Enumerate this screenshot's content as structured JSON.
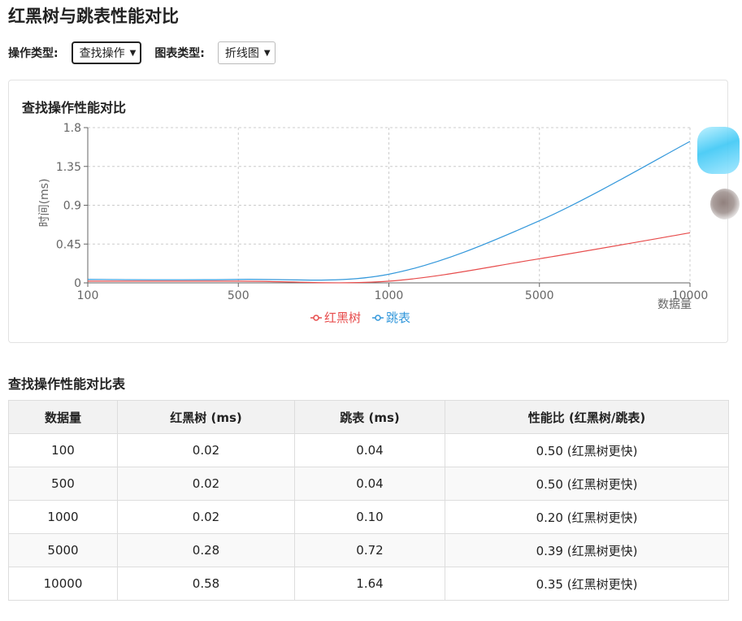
{
  "page": {
    "title": "红黑树与跳表性能对比",
    "op_label": "操作类型:",
    "op_value": "查找操作",
    "chart_label": "图表类型:",
    "chart_value": "折线图"
  },
  "chart_card": {
    "title": "查找操作性能对比"
  },
  "colors": {
    "rbtree": "#e74c4c",
    "skiplist": "#3498db"
  },
  "chart_data": {
    "type": "line",
    "title": "查找操作性能对比",
    "xlabel": "数据量",
    "ylabel": "时间(ms)",
    "categories": [
      "100",
      "500",
      "1000",
      "5000",
      "10000"
    ],
    "ylim": [
      0,
      1.8
    ],
    "yticks": [
      0,
      0.45,
      0.9,
      1.35,
      1.8
    ],
    "grid": true,
    "legend": "bottom",
    "series": [
      {
        "name": "红黑树",
        "values": [
          0.02,
          0.02,
          0.02,
          0.28,
          0.58
        ]
      },
      {
        "name": "跳表",
        "values": [
          0.04,
          0.04,
          0.1,
          0.72,
          1.64
        ]
      }
    ]
  },
  "table": {
    "title": "查找操作性能对比表",
    "headers": [
      "数据量",
      "红黑树 (ms)",
      "跳表 (ms)",
      "性能比 (红黑树/跳表)"
    ],
    "rows": [
      [
        "100",
        "0.02",
        "0.04",
        "0.50 (红黑树更快)"
      ],
      [
        "500",
        "0.02",
        "0.04",
        "0.50 (红黑树更快)"
      ],
      [
        "1000",
        "0.02",
        "0.10",
        "0.20 (红黑树更快)"
      ],
      [
        "5000",
        "0.28",
        "0.72",
        "0.39 (红黑树更快)"
      ],
      [
        "10000",
        "0.58",
        "1.64",
        "0.35 (红黑树更快)"
      ]
    ]
  }
}
